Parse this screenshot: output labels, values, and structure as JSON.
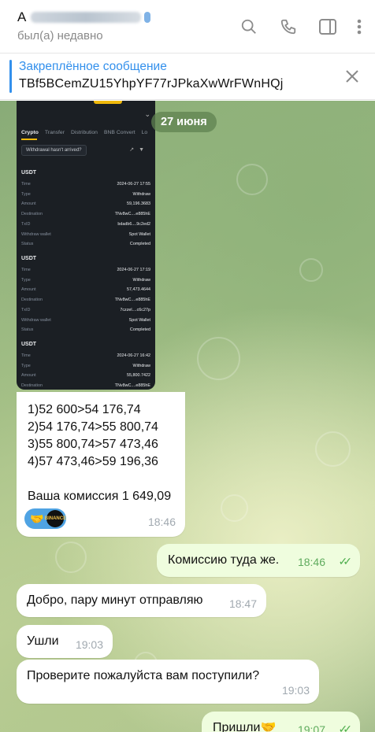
{
  "header": {
    "title_prefix": "A",
    "status": "был(а) недавно",
    "icons": [
      "search-icon",
      "phone-icon",
      "sidebar-icon",
      "more-icon"
    ]
  },
  "pinned": {
    "label": "Закреплённое сообщение",
    "text": "TBf5BCemZU15YhpYF77rJPkaXwWrFWnHQj"
  },
  "date": "27 июня",
  "screenshot": {
    "tabs": [
      "Crypto",
      "Transfer",
      "Distribution",
      "BNB Convert",
      "Lo"
    ],
    "button": "Withdrawal hasn't arrived?",
    "records": [
      {
        "coin": "USDT",
        "rows": [
          [
            "Time",
            "2024-06-27 17:55"
          ],
          [
            "Type",
            "Withdraw"
          ],
          [
            "Amount",
            "59,196.3683"
          ],
          [
            "Destination",
            "TNv8wC....e885hE"
          ],
          [
            "TxID",
            "bdadb6....9c2ed2"
          ],
          [
            "Withdraw wallet",
            "Spot Wallet"
          ],
          [
            "Status",
            "Completed"
          ]
        ]
      },
      {
        "coin": "USDT",
        "rows": [
          [
            "Time",
            "2024-06-27 17:19"
          ],
          [
            "Type",
            "Withdraw"
          ],
          [
            "Amount",
            "57,473.4644"
          ],
          [
            "Destination",
            "TNv8wC....e885hE"
          ],
          [
            "TxID",
            "7czzel....c6c27p"
          ],
          [
            "Withdraw wallet",
            "Spot Wallet"
          ],
          [
            "Status",
            "Completed"
          ]
        ]
      },
      {
        "coin": "USDT",
        "rows": [
          [
            "Time",
            "2024-06-27 16:42"
          ],
          [
            "Type",
            "Withdraw"
          ],
          [
            "Amount",
            "55,800.7422"
          ],
          [
            "Destination",
            "TNv8wC....e885hE"
          ]
        ]
      }
    ]
  },
  "messages": [
    {
      "dir": "in",
      "lines": [
        "1)52 600>54 176,74",
        "2)54 176,74>55 800,74",
        "3)55 800,74>57 473,46",
        "4)57 473,46>59 196,36",
        "",
        "Ваша комиссия 1 649,09"
      ],
      "time": "18:46",
      "reaction": "🤝",
      "reaction_avatar": "BINANCE"
    },
    {
      "dir": "out",
      "text": "Комиссию туда же.",
      "time": "18:46"
    },
    {
      "dir": "in",
      "text": "Добро, пару минут отправляю",
      "time": "18:47"
    },
    {
      "dir": "in",
      "text": "Ушли",
      "time": "19:03"
    },
    {
      "dir": "in",
      "text": "Проверите пожалуйста вам поступили?",
      "time": "19:03"
    },
    {
      "dir": "out",
      "text": "Пришли🤝",
      "time": "19:07"
    }
  ]
}
